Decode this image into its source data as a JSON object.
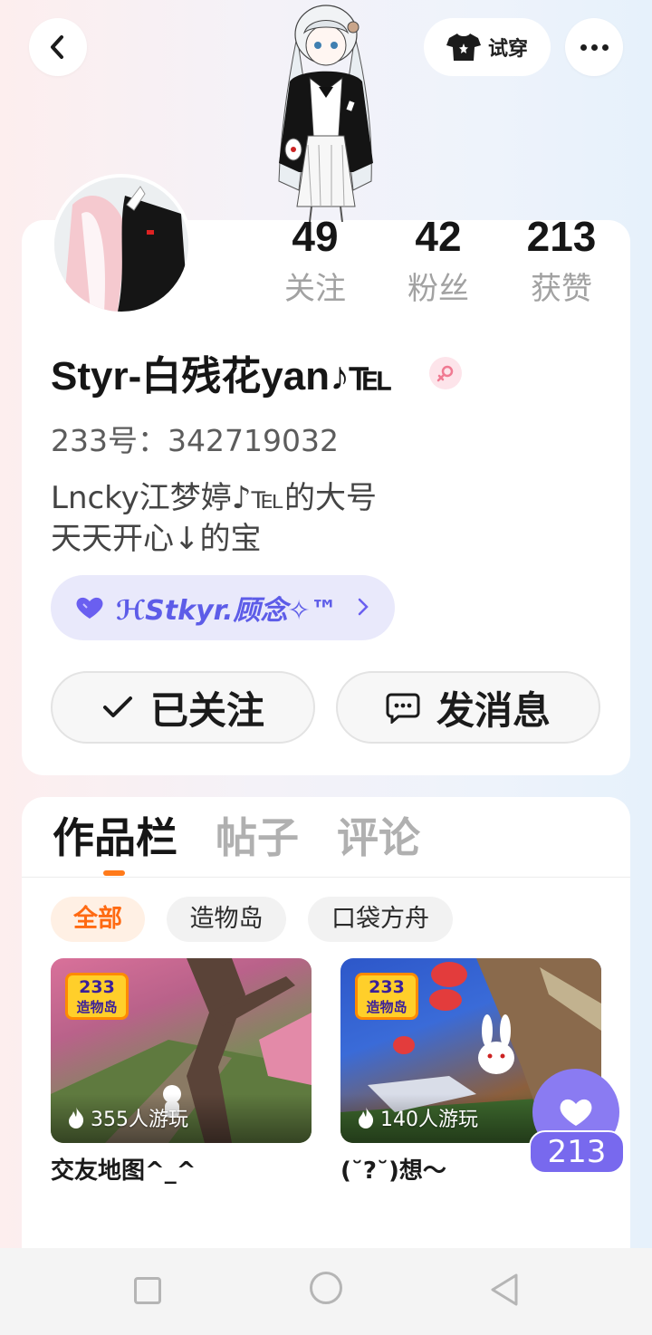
{
  "header": {
    "tryon_label": "试穿"
  },
  "stats": {
    "following": {
      "value": "49",
      "label": "关注"
    },
    "fans": {
      "value": "42",
      "label": "粉丝"
    },
    "likes": {
      "value": "213",
      "label": "获赞"
    }
  },
  "profile": {
    "username": "Styr-白残花yan♪℡",
    "uid": "233号：342719032",
    "bio": "Lncky江梦婷♪℡的大号\n天天开心↓的宝",
    "group_name": "ℋStkyr.顾念✧™",
    "gender": "female"
  },
  "actions": {
    "followed_label": "已关注",
    "message_label": "发消息"
  },
  "tabs": [
    {
      "label": "作品栏",
      "active": true
    },
    {
      "label": "帖子",
      "active": false
    },
    {
      "label": "评论",
      "active": false
    }
  ],
  "filters": [
    {
      "label": "全部",
      "active": true
    },
    {
      "label": "造物岛",
      "active": false
    },
    {
      "label": "口袋方舟",
      "active": false
    }
  ],
  "works": [
    {
      "title": "交友地图^_^",
      "plays": "355人游玩",
      "logo_top": "233",
      "logo_bottom": "造物岛"
    },
    {
      "title": "(˘?˘)想〜",
      "plays": "140人游玩",
      "logo_top": "233",
      "logo_bottom": "造物岛"
    }
  ],
  "like_fab": {
    "count": "213"
  },
  "colors": {
    "accent_orange": "#ff7a1a",
    "group_purple": "#5d5ce8",
    "like_purple": "#7869ee"
  }
}
